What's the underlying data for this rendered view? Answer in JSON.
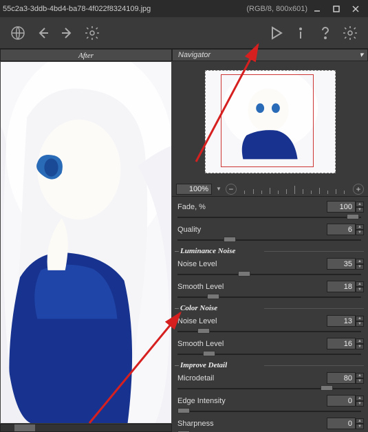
{
  "window": {
    "title": "55c2a3-3ddb-4bd4-ba78-4f022f8324109.jpg",
    "mode": "(RGB/8, 800x601)"
  },
  "tabs": {
    "after": "After"
  },
  "navigator": {
    "title": "Navigator",
    "zoom": "100%"
  },
  "params": {
    "fade": {
      "label": "Fade, %",
      "value": "100"
    },
    "quality": {
      "label": "Quality",
      "value": "6"
    },
    "group_lum": "Luminance Noise",
    "lum_noise": {
      "label": "Noise Level",
      "value": "35"
    },
    "lum_smooth": {
      "label": "Smooth Level",
      "value": "18"
    },
    "group_color": "Color Noise",
    "col_noise": {
      "label": "Noise Level",
      "value": "13"
    },
    "col_smooth": {
      "label": "Smooth Level",
      "value": "16"
    },
    "group_detail": "Improve Detail",
    "micro": {
      "label": "Microdetail",
      "value": "80"
    },
    "edge": {
      "label": "Edge Intensity",
      "value": "0"
    },
    "sharp": {
      "label": "Sharpness",
      "value": "0"
    }
  }
}
